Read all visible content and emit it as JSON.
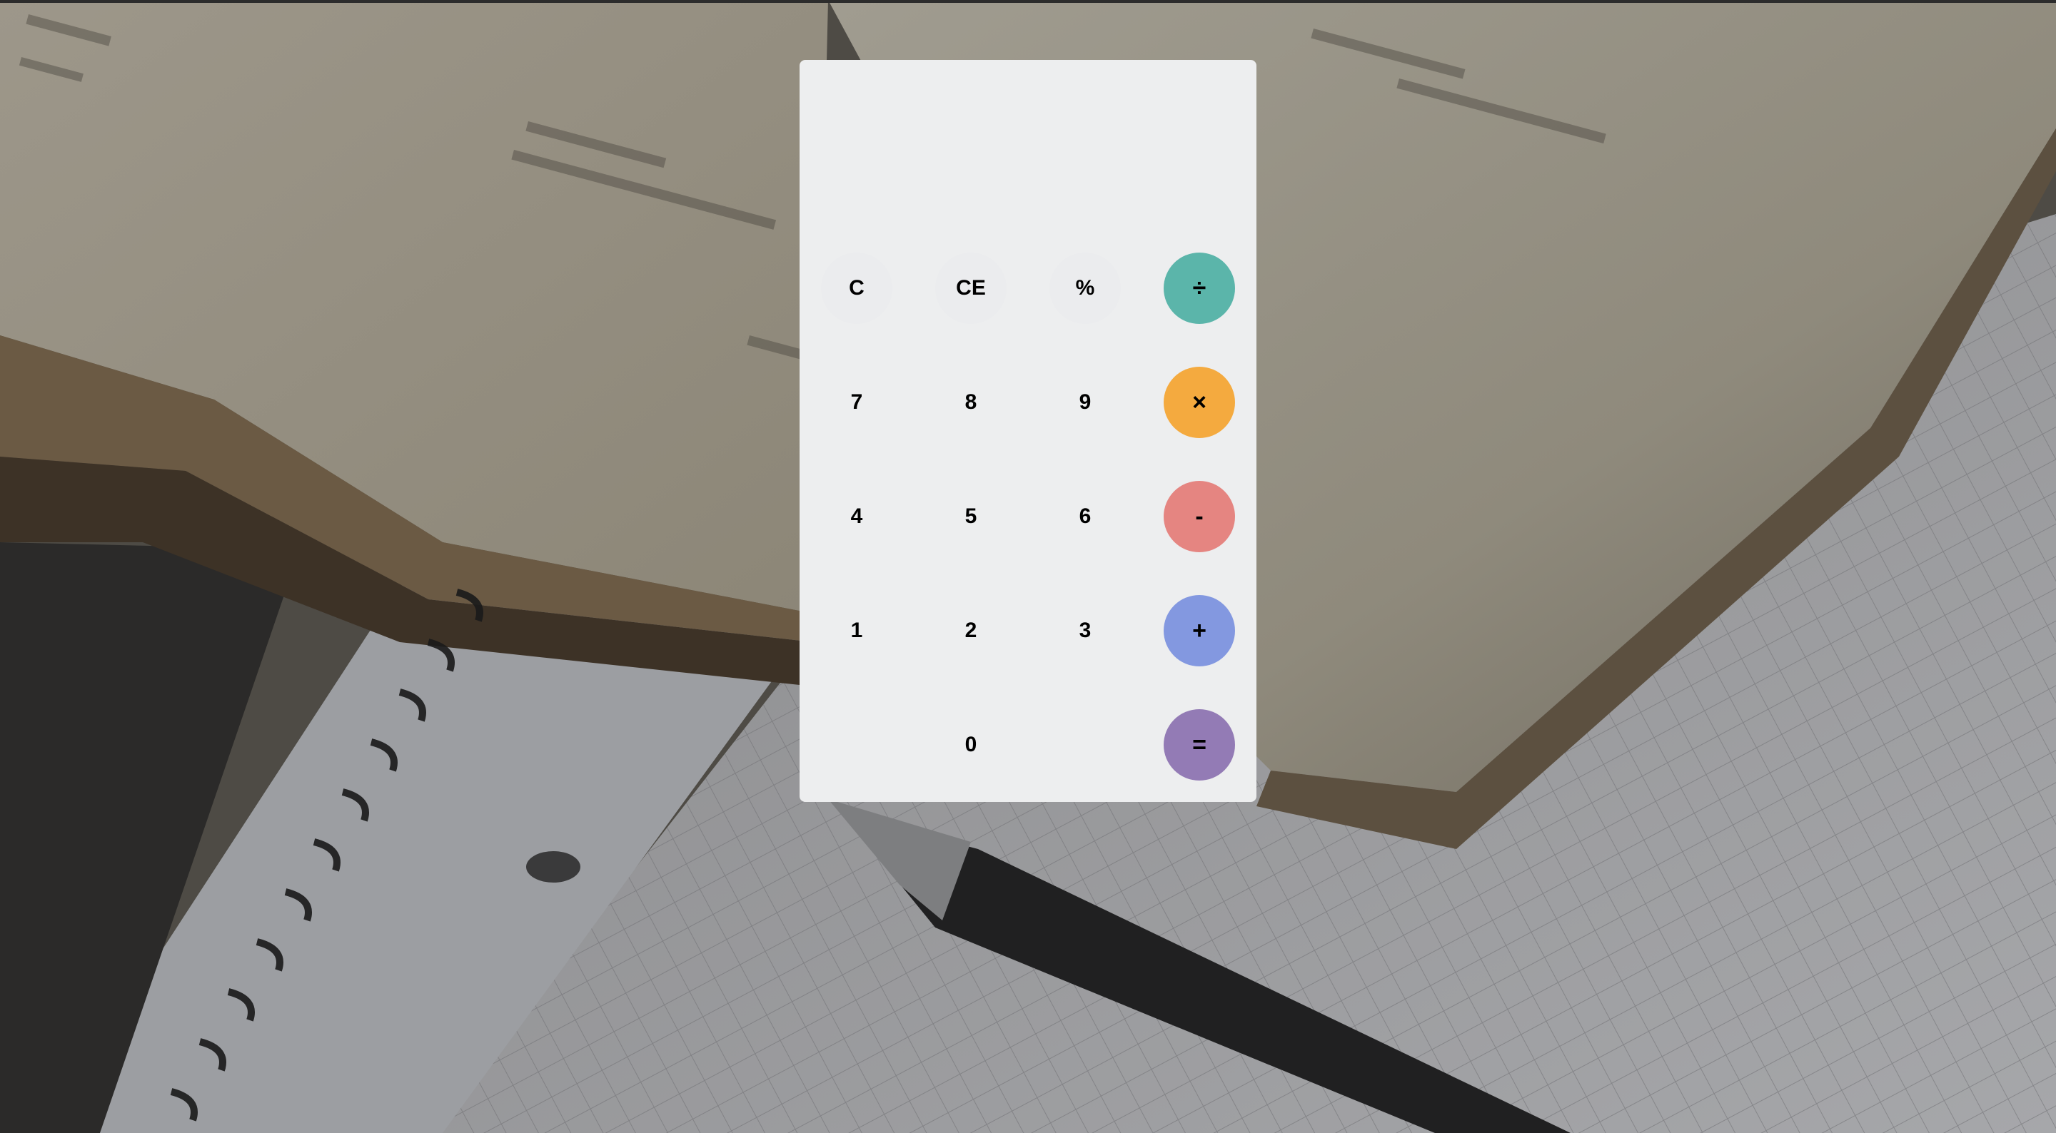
{
  "calculator": {
    "display_value": "",
    "keys": {
      "clear": "C",
      "clear_entry": "CE",
      "percent": "%",
      "divide": "÷",
      "seven": "7",
      "eight": "8",
      "nine": "9",
      "multiply": "×",
      "four": "4",
      "five": "5",
      "six": "6",
      "minus": "-",
      "one": "1",
      "two": "2",
      "three": "3",
      "plus": "+",
      "zero": "0",
      "equals": "="
    },
    "colors": {
      "panel": "#edeeef",
      "divide": "#5bb5aa",
      "multiply": "#f4aa3f",
      "minus": "#e58581",
      "plus": "#8398e0",
      "equals": "#937bb5"
    }
  }
}
